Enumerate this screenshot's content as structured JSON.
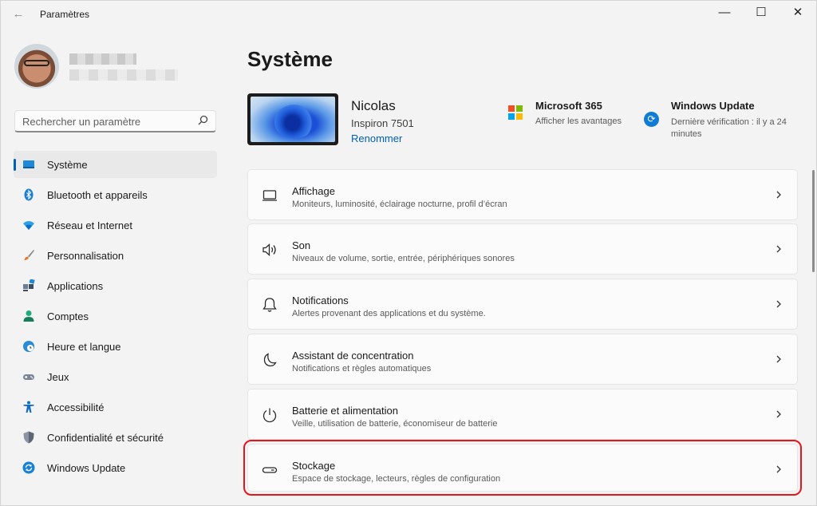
{
  "window": {
    "title": "Paramètres",
    "back_icon": "arrow-left-icon",
    "controls": [
      "minimize-icon",
      "maximize-icon",
      "close-icon"
    ]
  },
  "search": {
    "placeholder": "Rechercher un paramètre",
    "icon": "search-icon"
  },
  "sidebar": {
    "items": [
      {
        "label": "Système",
        "icon": "monitor-icon",
        "active": true
      },
      {
        "label": "Bluetooth et appareils",
        "icon": "bluetooth-icon"
      },
      {
        "label": "Réseau et Internet",
        "icon": "wifi-icon"
      },
      {
        "label": "Personnalisation",
        "icon": "brush-icon"
      },
      {
        "label": "Applications",
        "icon": "apps-icon"
      },
      {
        "label": "Comptes",
        "icon": "person-icon"
      },
      {
        "label": "Heure et langue",
        "icon": "globe-clock-icon"
      },
      {
        "label": "Jeux",
        "icon": "gamepad-icon"
      },
      {
        "label": "Accessibilité",
        "icon": "accessibility-icon"
      },
      {
        "label": "Confidentialité et sécurité",
        "icon": "shield-icon"
      },
      {
        "label": "Windows Update",
        "icon": "update-icon"
      }
    ]
  },
  "main": {
    "title": "Système",
    "device": {
      "name": "Nicolas",
      "model": "Inspiron 7501",
      "rename_label": "Renommer"
    },
    "microsoft365": {
      "title": "Microsoft 365",
      "subtitle": "Afficher les avantages",
      "icon": "microsoft-logo-icon",
      "colors": [
        "#f25022",
        "#7fba00",
        "#00a4ef",
        "#ffb900"
      ]
    },
    "windows_update": {
      "title": "Windows Update",
      "subtitle": "Dernière vérification : il y a 24 minutes",
      "icon": "update-icon"
    },
    "settings": [
      {
        "title": "Affichage",
        "subtitle": "Moniteurs, luminosité, éclairage nocturne, profil d’écran",
        "icon": "display-icon"
      },
      {
        "title": "Son",
        "subtitle": "Niveaux de volume, sortie, entrée, périphériques sonores",
        "icon": "speaker-icon"
      },
      {
        "title": "Notifications",
        "subtitle": "Alertes provenant des applications et du système.",
        "icon": "bell-icon"
      },
      {
        "title": "Assistant de concentration",
        "subtitle": "Notifications et règles automatiques",
        "icon": "moon-icon"
      },
      {
        "title": "Batterie et alimentation",
        "subtitle": "Veille, utilisation de batterie, économiseur de batterie",
        "icon": "power-icon"
      },
      {
        "title": "Stockage",
        "subtitle": "Espace de stockage, lecteurs, règles de configuration",
        "icon": "drive-icon",
        "highlighted": true
      }
    ]
  },
  "colors": {
    "accent": "#005fb8",
    "highlight_box": "#e8141c",
    "background": "#f3f3f3",
    "card": "#fbfbfb"
  }
}
